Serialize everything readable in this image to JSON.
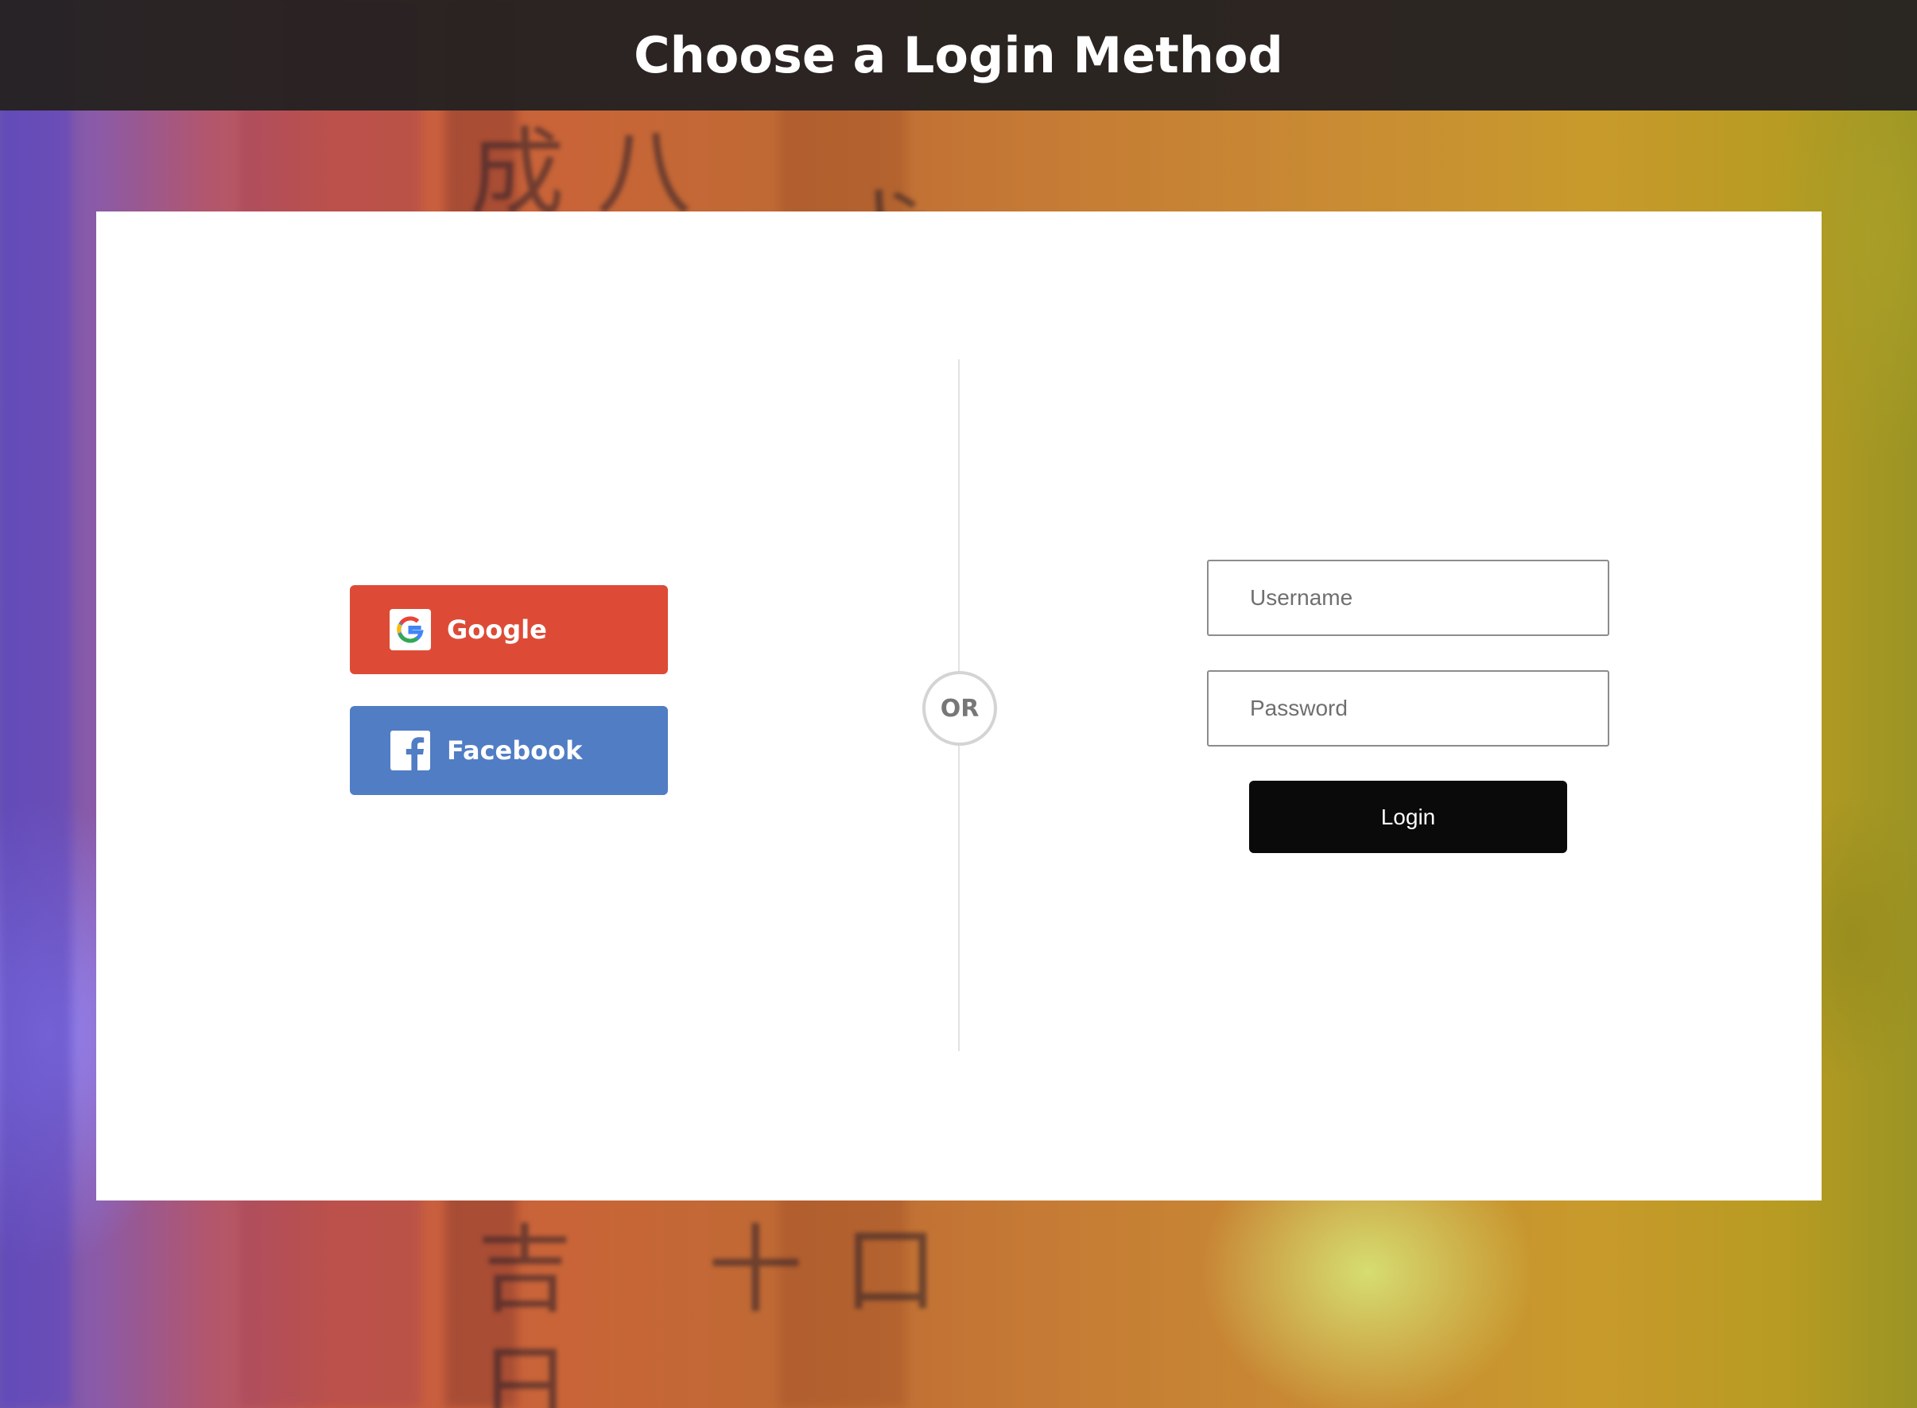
{
  "header": {
    "title": "Choose a Login Method"
  },
  "social": {
    "google_label": "Google",
    "facebook_label": "Facebook"
  },
  "divider": {
    "or_label": "OR"
  },
  "form": {
    "username_placeholder": "Username",
    "username_value": "",
    "password_placeholder": "Password",
    "password_value": "",
    "login_label": "Login"
  },
  "colors": {
    "header_bg": "#262222",
    "google": "#dd4b36",
    "facebook": "#507dc4",
    "login_button": "#0a0a0a"
  },
  "icons": {
    "google": "google-logo-icon",
    "facebook": "facebook-logo-icon"
  }
}
